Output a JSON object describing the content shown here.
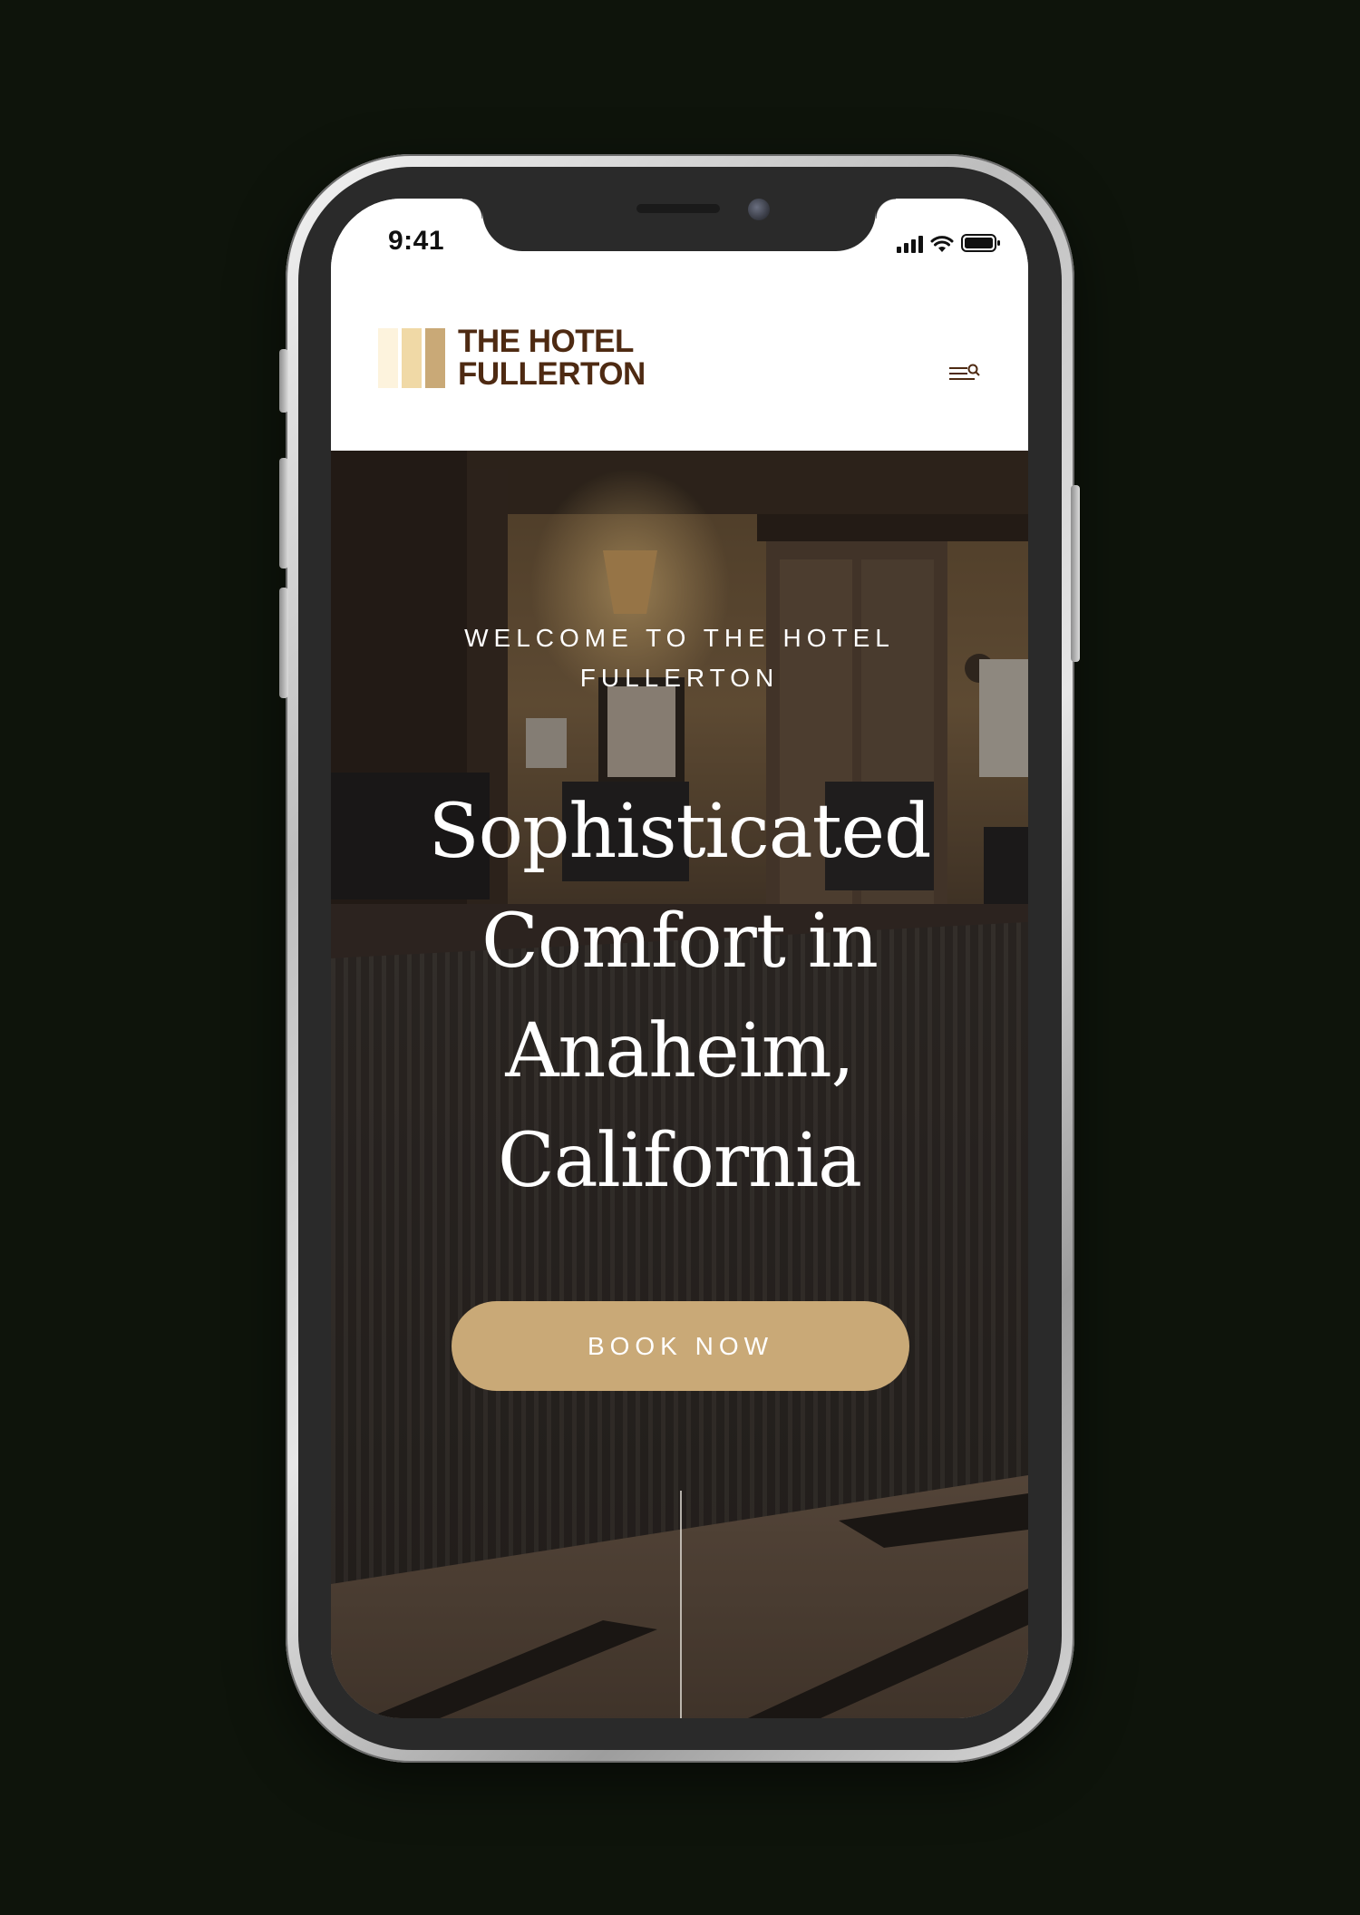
{
  "status_bar": {
    "time": "9:41"
  },
  "header": {
    "logo_line1": "THE HOTEL",
    "logo_line2": "FULLERTON",
    "logo_colors": [
      "#fdf3dd",
      "#f0d9a6",
      "#c9a977"
    ],
    "menu_icon": "menu-search-icon"
  },
  "hero": {
    "eyebrow_line1": "WELCOME TO THE HOTEL",
    "eyebrow_line2": "FULLERTON",
    "title_lines": [
      "Sophisticated",
      "Comfort in",
      "Anaheim,",
      "California"
    ],
    "cta_label": "BOOK NOW"
  },
  "colors": {
    "brand_brown": "#4e2a12",
    "accent_gold": "#c9a977",
    "page_background": "#0e140b",
    "white": "#ffffff"
  }
}
